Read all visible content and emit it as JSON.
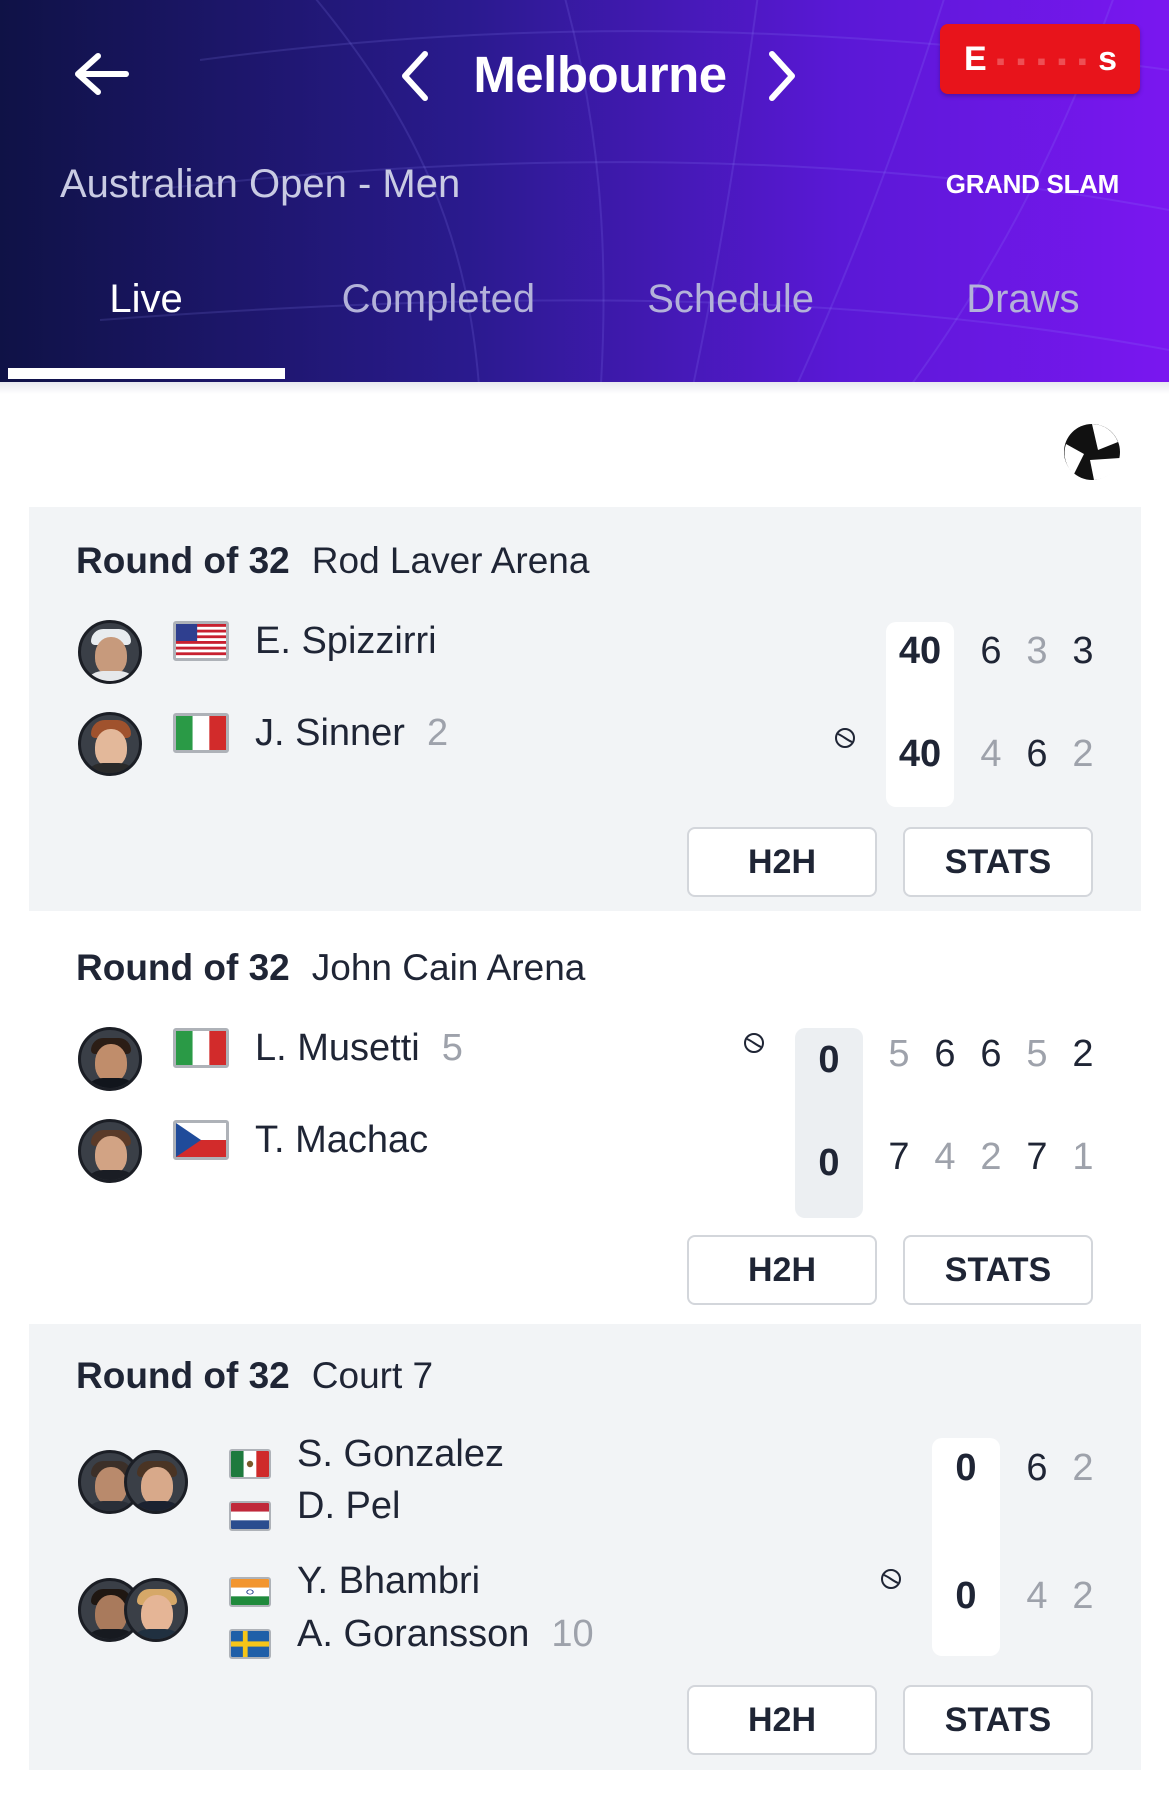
{
  "header": {
    "city": "Melbourne",
    "tournament": "Australian Open - Men",
    "category": "GRAND SLAM",
    "sponsor_visible": "E",
    "sponsor_tail": "s"
  },
  "tabs": [
    {
      "label": "Live",
      "active": true
    },
    {
      "label": "Completed",
      "active": false
    },
    {
      "label": "Schedule",
      "active": false
    },
    {
      "label": "Draws",
      "active": false
    }
  ],
  "colors": {
    "accent": "#7a17f0",
    "header_dark": "#0f1246",
    "sponsor": "#e8141b",
    "tab_inactive": "#b3b2d9"
  },
  "matches": [
    {
      "round": "Round of 32",
      "court": "Rod Laver Arena",
      "players": [
        {
          "name": "E. Spizzirri",
          "seed": "",
          "country": "USA",
          "points": "40",
          "serving": false,
          "sets": [
            "6",
            "3",
            "3"
          ]
        },
        {
          "name": "J. Sinner",
          "seed": "2",
          "country": "ITA",
          "points": "40",
          "serving": true,
          "sets": [
            "4",
            "6",
            "2"
          ]
        }
      ],
      "buttons": {
        "h2h": "H2H",
        "stats": "STATS"
      }
    },
    {
      "round": "Round of 32",
      "court": "John Cain Arena",
      "players": [
        {
          "name": "L. Musetti",
          "seed": "5",
          "country": "ITA",
          "points": "0",
          "serving": true,
          "sets": [
            "5",
            "6",
            "6",
            "5",
            "2"
          ]
        },
        {
          "name": "T. Machac",
          "seed": "",
          "country": "CZE",
          "points": "0",
          "serving": false,
          "sets": [
            "7",
            "4",
            "2",
            "7",
            "1"
          ]
        }
      ],
      "buttons": {
        "h2h": "H2H",
        "stats": "STATS"
      }
    },
    {
      "round": "Round of 32",
      "court": "Court 7",
      "teams": [
        {
          "players": [
            {
              "name": "S. Gonzalez",
              "country": "MEX"
            },
            {
              "name": "D. Pel",
              "country": "NED"
            }
          ],
          "seed": "",
          "points": "0",
          "serving": false,
          "sets": [
            "6",
            "2"
          ]
        },
        {
          "players": [
            {
              "name": "Y. Bhambri",
              "country": "IND"
            },
            {
              "name": "A. Goransson",
              "country": "SWE"
            }
          ],
          "seed": "10",
          "points": "0",
          "serving": true,
          "sets": [
            "4",
            "2"
          ]
        }
      ],
      "buttons": {
        "h2h": "H2H",
        "stats": "STATS"
      }
    }
  ]
}
